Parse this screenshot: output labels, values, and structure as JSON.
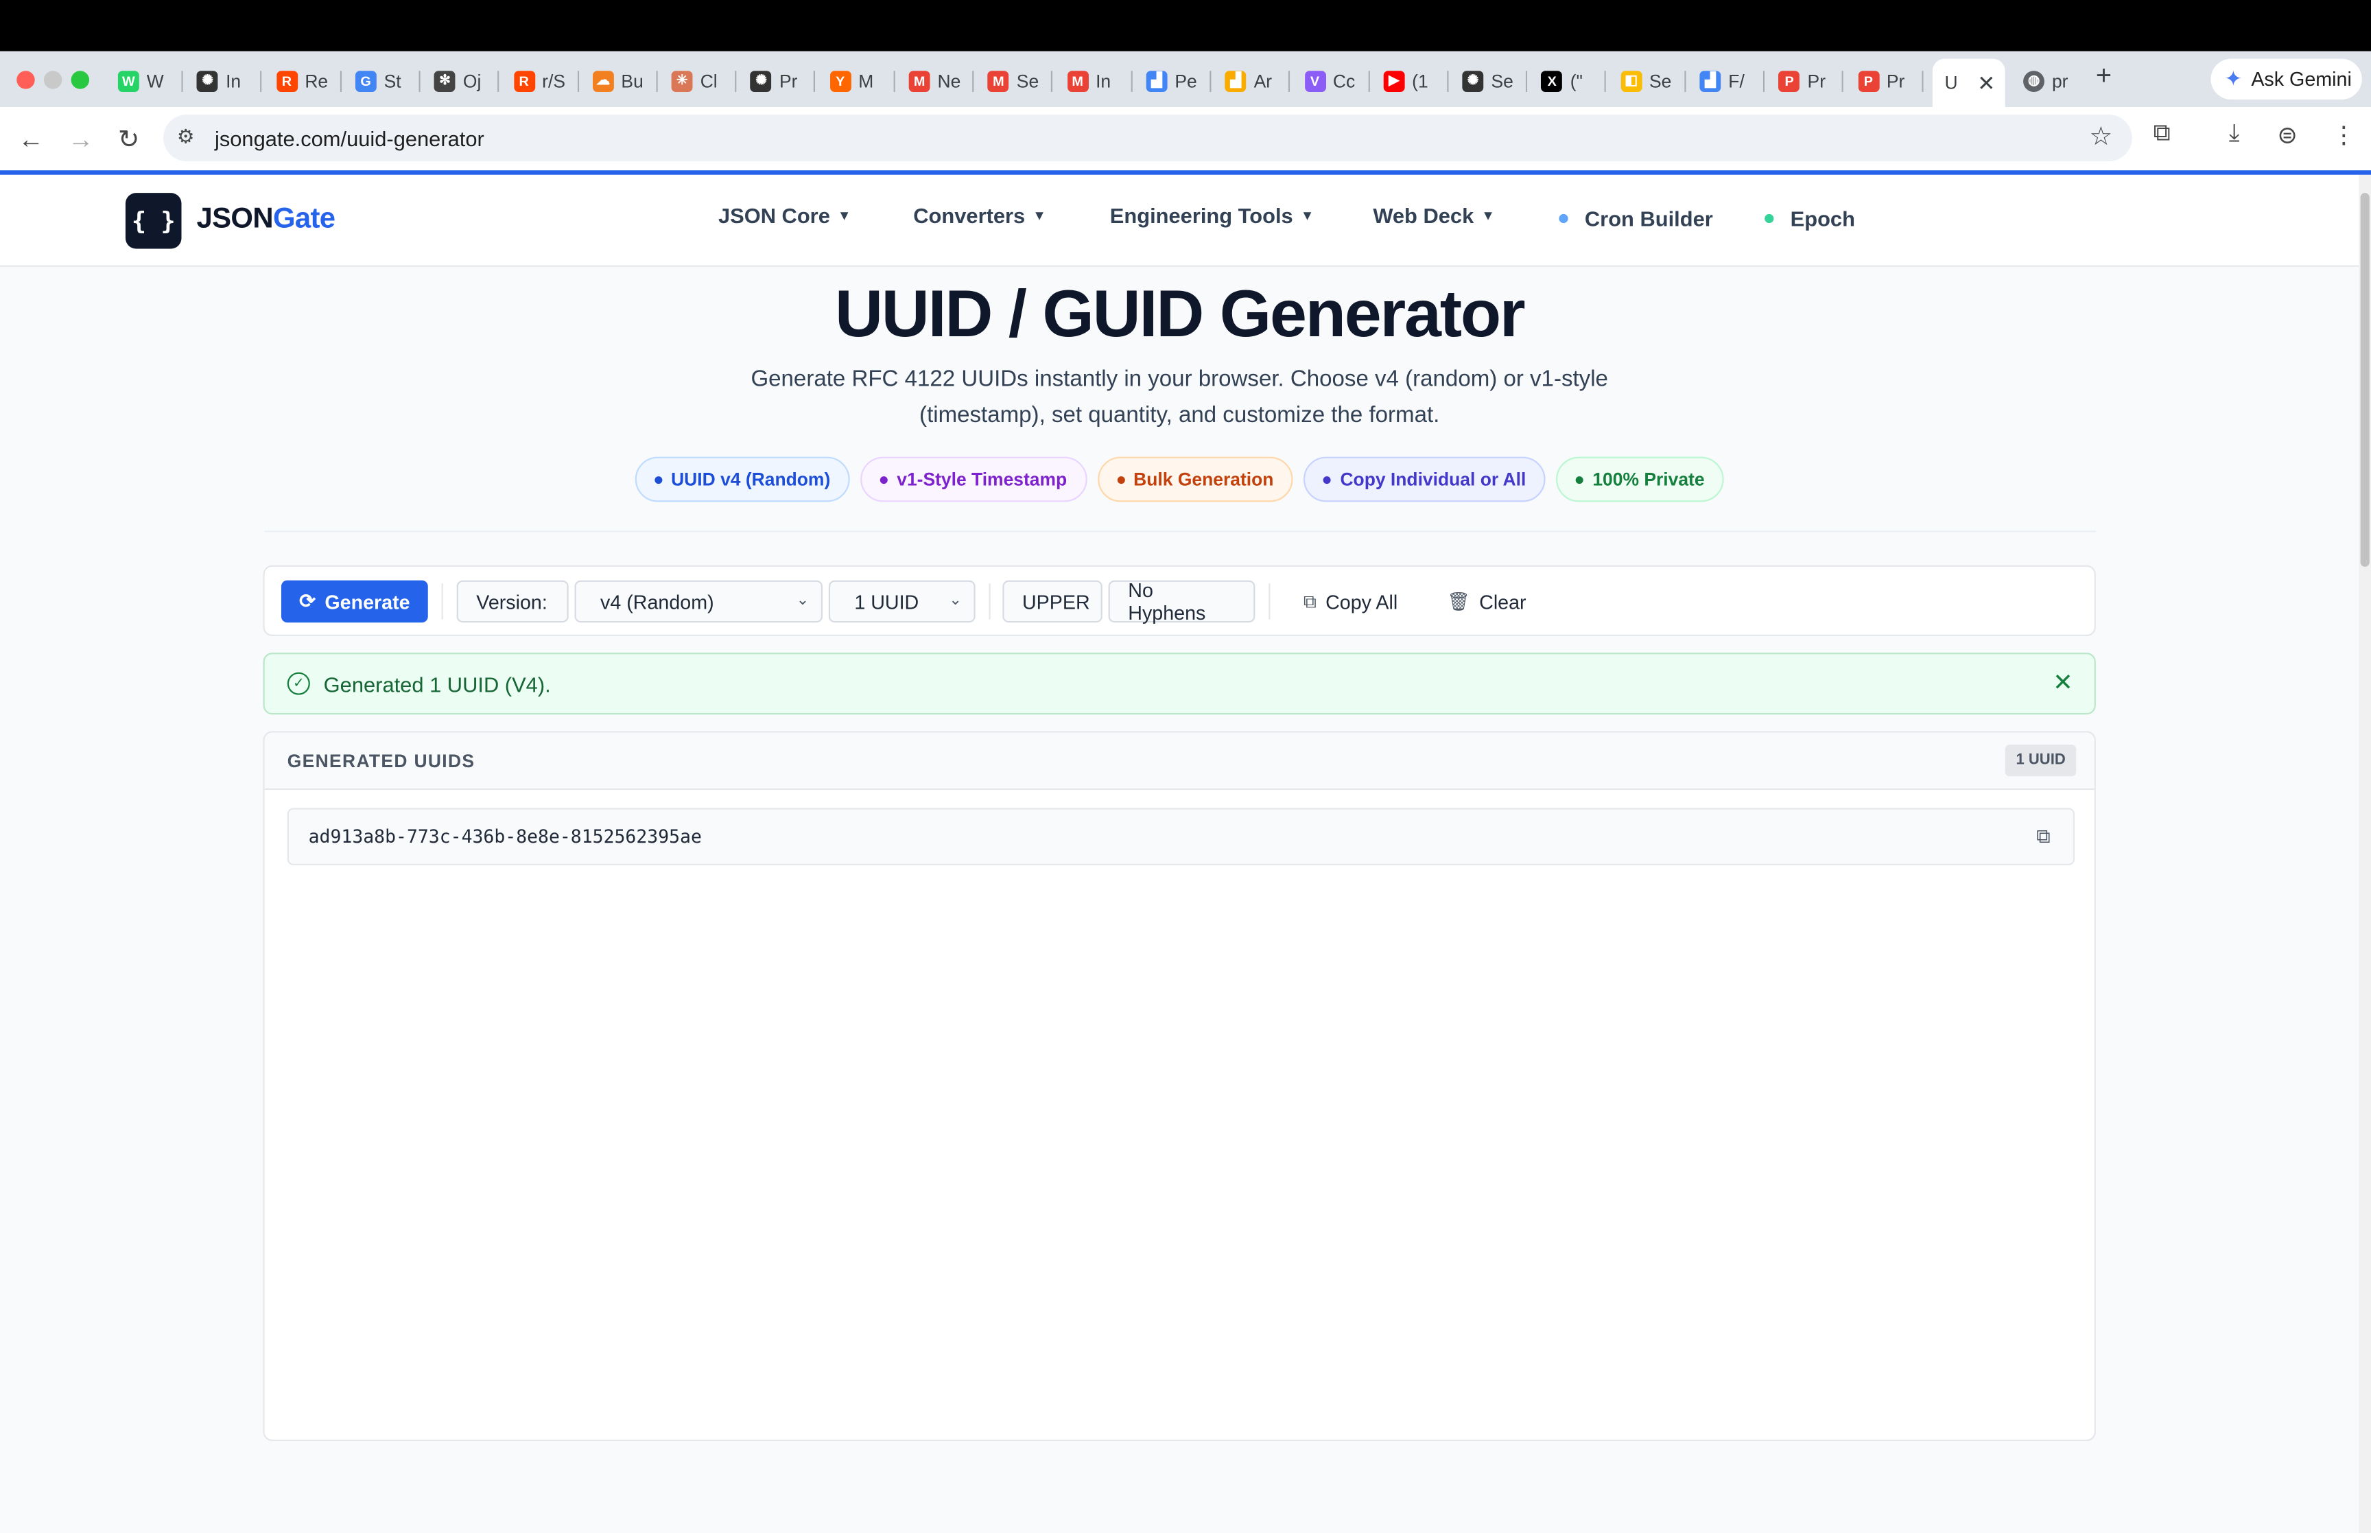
{
  "browser": {
    "tabs": [
      {
        "label": "W",
        "fav": "whatsapp-icon",
        "color": "#25d366",
        "glyph": "W"
      },
      {
        "label": "In",
        "fav": "openai-icon",
        "color": "#333333",
        "glyph": "✺"
      },
      {
        "label": "Re",
        "fav": "reddit-icon",
        "color": "#ff4500",
        "glyph": "R"
      },
      {
        "label": "St",
        "fav": "google-icon",
        "color": "#4285f4",
        "glyph": "G"
      },
      {
        "label": "Oj",
        "fav": "asterisk-icon",
        "color": "#444444",
        "glyph": "✻"
      },
      {
        "label": "r/S",
        "fav": "reddit-icon",
        "color": "#ff4500",
        "glyph": "R"
      },
      {
        "label": "Bu",
        "fav": "cloudflare-icon",
        "color": "#f38020",
        "glyph": "☁"
      },
      {
        "label": "Cl",
        "fav": "claude-icon",
        "color": "#d97757",
        "glyph": "✳"
      },
      {
        "label": "Pr",
        "fav": "openai-icon",
        "color": "#333333",
        "glyph": "✺"
      },
      {
        "label": "M",
        "fav": "ycombinator-icon",
        "color": "#ff6600",
        "glyph": "Y"
      },
      {
        "label": "Ne",
        "fav": "gmail-icon",
        "color": "#ea4335",
        "glyph": "M"
      },
      {
        "label": "Se",
        "fav": "gmail-icon",
        "color": "#ea4335",
        "glyph": "M"
      },
      {
        "label": "In",
        "fav": "gmail-icon",
        "color": "#ea4335",
        "glyph": "M"
      },
      {
        "label": "Pe",
        "fav": "analytics-icon",
        "color": "#4285f4",
        "glyph": "▟"
      },
      {
        "label": "Ar",
        "fav": "analytics-icon",
        "color": "#f9ab00",
        "glyph": "▟"
      },
      {
        "label": "Cc",
        "fav": "vite-icon",
        "color": "#8b5cf6",
        "glyph": "V"
      },
      {
        "label": "(1",
        "fav": "youtube-icon",
        "color": "#ff0000",
        "glyph": "▶"
      },
      {
        "label": "Se",
        "fav": "openai-icon",
        "color": "#333333",
        "glyph": "✺"
      },
      {
        "label": "(\"",
        "fav": "x-icon",
        "color": "#000000",
        "glyph": "X"
      },
      {
        "label": "Se",
        "fav": "search-console-icon",
        "color": "#fbbc04",
        "glyph": "◧"
      },
      {
        "label": "F/",
        "fav": "analytics-icon",
        "color": "#4285f4",
        "glyph": "▟"
      },
      {
        "label": "Pr",
        "fav": "producthunt-icon",
        "color": "#ea4335",
        "glyph": "P"
      },
      {
        "label": "Pr",
        "fav": "producthunt-icon",
        "color": "#ea4335",
        "glyph": "P"
      }
    ],
    "active_tab_label": "U",
    "last_tab_label": "pr",
    "gemini_label": "Ask Gemini",
    "url": "jsongate.com/uuid-generator"
  },
  "site": {
    "logo_glyph": "{ }",
    "logo_json": "JSON",
    "logo_gate": "Gate",
    "nav": [
      {
        "label": "JSON Core",
        "dropdown": true
      },
      {
        "label": "Converters",
        "dropdown": true
      },
      {
        "label": "Engineering Tools",
        "dropdown": true
      },
      {
        "label": "Web Deck",
        "dropdown": true
      },
      {
        "label": "Cron Builder",
        "dot_color": "#60a5fa"
      },
      {
        "label": "Epoch",
        "dot_color": "#34d399"
      }
    ]
  },
  "hero": {
    "title": "UUID / GUID Generator",
    "description": "Generate RFC 4122 UUIDs instantly in your browser. Choose v4 (random) or v1-style (timestamp), set quantity, and customize the format.",
    "badges": [
      {
        "label": "UUID v4 (Random)",
        "color": "#1d4ed8",
        "bg": "#eff6ff",
        "border": "#bfdbfe"
      },
      {
        "label": "v1-Style Timestamp",
        "color": "#7e22ce",
        "bg": "#faf5ff",
        "border": "#e9d5ff"
      },
      {
        "label": "Bulk Generation",
        "color": "#c2410c",
        "bg": "#fff7ed",
        "border": "#fed7aa"
      },
      {
        "label": "Copy Individual or All",
        "color": "#4338ca",
        "bg": "#eef2ff",
        "border": "#c7d2fe"
      },
      {
        "label": "100% Private",
        "color": "#15803d",
        "bg": "#f0fdf4",
        "border": "#bbf7d0"
      }
    ]
  },
  "toolbar": {
    "generate_label": "Generate",
    "version_label": "Version:",
    "version_value": "v4 (Random)",
    "count_value": "1 UUID",
    "upper_label": "UPPER",
    "no_hyphens_label": "No Hyphens",
    "copy_all_label": "Copy All",
    "clear_label": "Clear"
  },
  "alert": {
    "message": "Generated 1 UUID (V4)."
  },
  "results": {
    "title": "GENERATED UUIDS",
    "count_badge": "1 UUID",
    "uuids": [
      "ad913a8b-773c-436b-8e8e-8152562395ae"
    ]
  }
}
